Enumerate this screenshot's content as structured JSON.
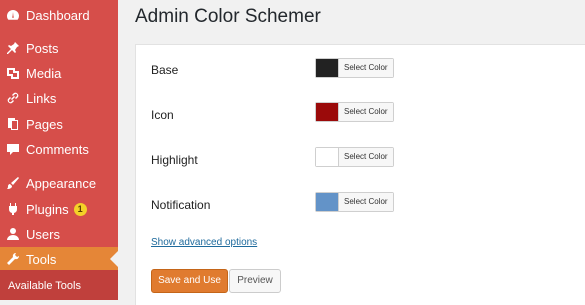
{
  "sidebar": {
    "items": [
      {
        "label": "Dashboard",
        "icon": "dashboard-icon"
      },
      {
        "label": "Posts",
        "icon": "pin-icon"
      },
      {
        "label": "Media",
        "icon": "media-icon"
      },
      {
        "label": "Links",
        "icon": "link-icon"
      },
      {
        "label": "Pages",
        "icon": "pages-icon"
      },
      {
        "label": "Comments",
        "icon": "comment-icon"
      },
      {
        "label": "Appearance",
        "icon": "brush-icon"
      },
      {
        "label": "Plugins",
        "icon": "plugin-icon",
        "badge": "1"
      },
      {
        "label": "Users",
        "icon": "user-icon"
      },
      {
        "label": "Tools",
        "icon": "wrench-icon",
        "active": true
      }
    ],
    "submenu": {
      "label": "Available Tools"
    },
    "colors": {
      "background": "#d64e4a",
      "active": "#e58637",
      "badge": "#f4d128"
    }
  },
  "main": {
    "title": "Admin Color Schemer",
    "fields": [
      {
        "label": "Base",
        "color": "#222222",
        "button_label": "Select Color"
      },
      {
        "label": "Icon",
        "color": "#9b0a0a",
        "button_label": "Select Color"
      },
      {
        "label": "Highlight",
        "color": "#ffffff",
        "button_label": "Select Color"
      },
      {
        "label": "Notification",
        "color": "#6393c8",
        "button_label": "Select Color"
      }
    ],
    "advanced_link": "Show advanced options",
    "save_label": "Save and Use",
    "preview_label": "Preview"
  }
}
